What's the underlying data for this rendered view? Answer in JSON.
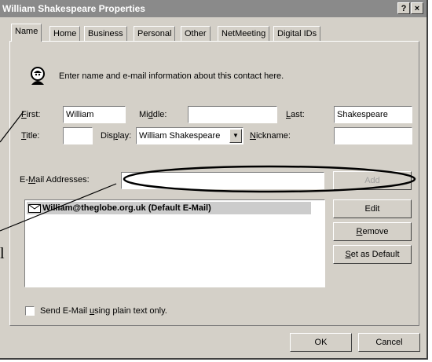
{
  "window": {
    "title": "William Shakespeare Properties",
    "help_label": "?",
    "close_label": "×"
  },
  "tabs": [
    {
      "label": "Name"
    },
    {
      "label": "Home"
    },
    {
      "label": "Business"
    },
    {
      "label": "Personal"
    },
    {
      "label": "Other"
    },
    {
      "label": "NetMeeting"
    },
    {
      "label": "Digital IDs"
    }
  ],
  "header": {
    "icon": "contact-icon",
    "text": "Enter name and e-mail information about this contact here."
  },
  "name_fields": {
    "first": {
      "label_ul": "F",
      "label_rest": "irst:",
      "value": "William"
    },
    "middle": {
      "label_pre": "Mi",
      "label_ul": "d",
      "label_rest": "dle:",
      "value": ""
    },
    "last": {
      "label_ul": "L",
      "label_rest": "ast:",
      "value": "Shakespeare"
    },
    "title": {
      "label_ul": "T",
      "label_rest": "itle:",
      "value": ""
    },
    "display": {
      "label_pre": "Dis",
      "label_ul": "p",
      "label_rest": "lay:",
      "value": "William Shakespeare"
    },
    "nickname": {
      "label_ul": "N",
      "label_rest": "ickname:",
      "value": ""
    }
  },
  "email": {
    "label_pre": "E-",
    "label_ul": "M",
    "label_rest": "ail Addresses:",
    "input_value": "",
    "add_label": "Add",
    "list": [
      {
        "address": "William@theglobe.org.uk",
        "suffix": "(Default E-Mail)"
      }
    ],
    "edit_label": "Edit",
    "remove_ul": "R",
    "remove_rest": "emove",
    "default_ul": "S",
    "default_rest": "et as Default"
  },
  "plain_text": {
    "label_pre": "Send E-Mail ",
    "label_ul": "u",
    "label_rest": "sing plain text only.",
    "checked": false
  },
  "footer": {
    "ok_label": "OK",
    "cancel_label": "Cancel"
  },
  "margin_text": {
    "char": "l"
  }
}
